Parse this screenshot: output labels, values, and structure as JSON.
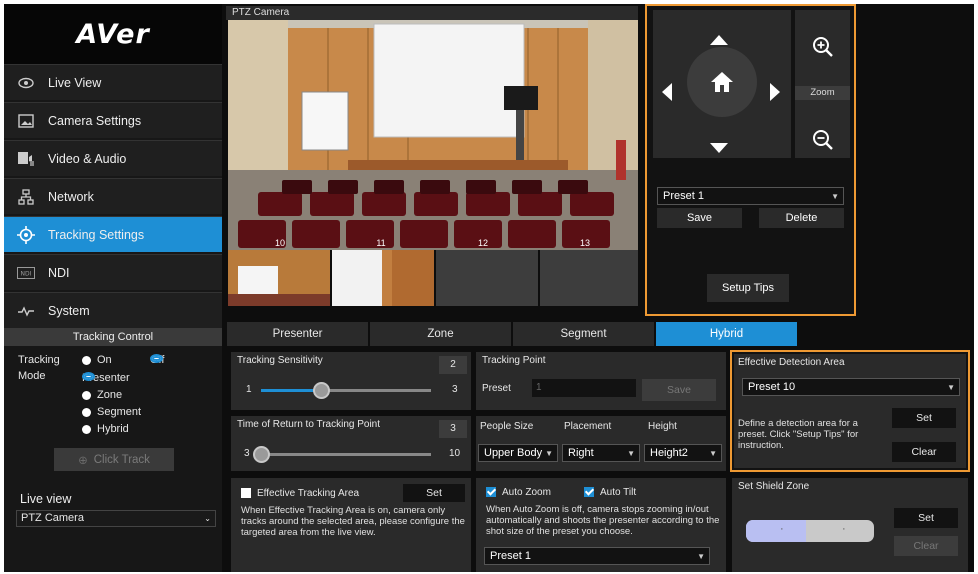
{
  "brand": {
    "logo_text": "AVer"
  },
  "sidebar": {
    "items": [
      {
        "label": "Live View",
        "icon": "eye-icon"
      },
      {
        "label": "Camera Settings",
        "icon": "image-icon"
      },
      {
        "label": "Video & Audio",
        "icon": "film-audio-icon"
      },
      {
        "label": "Network",
        "icon": "network-icon"
      },
      {
        "label": "Tracking Settings",
        "icon": "target-icon",
        "active": true
      },
      {
        "label": "NDI",
        "icon": "ndi-icon"
      },
      {
        "label": "System",
        "icon": "pulse-icon"
      }
    ],
    "tracking_control": {
      "header": "Tracking Control",
      "tracking_label": "Tracking",
      "mode_label": "Mode",
      "on_label": "On",
      "off_label": "Off",
      "state": "Off",
      "modes": [
        "Presenter",
        "Zone",
        "Segment",
        "Hybrid"
      ],
      "selected_mode": "Presenter",
      "click_track_label": "Click Track"
    },
    "live_view": {
      "label": "Live view",
      "selected": "PTZ Camera"
    }
  },
  "camera": {
    "title": "PTZ Camera",
    "segment_numbers": [
      "10",
      "11",
      "12",
      "13"
    ]
  },
  "ptz": {
    "zoom_label": "Zoom",
    "preset_selected": "Preset 1",
    "save_label": "Save",
    "delete_label": "Delete",
    "setup_tips_label": "Setup Tips"
  },
  "tabs": [
    {
      "label": "Presenter"
    },
    {
      "label": "Zone"
    },
    {
      "label": "Segment"
    },
    {
      "label": "Hybrid",
      "active": true
    }
  ],
  "tracking_sensitivity": {
    "title": "Tracking Sensitivity",
    "value": "2",
    "min": "1",
    "max": "3",
    "level": 2
  },
  "time_of_return": {
    "title": "Time of Return to Tracking Point",
    "value": "3",
    "min": "3",
    "max": "10",
    "level": 3
  },
  "tracking_point": {
    "title": "Tracking Point",
    "preset_label": "Preset",
    "preset_value": "1",
    "save_label": "Save"
  },
  "people": {
    "size_header": "People Size",
    "placement_header": "Placement",
    "height_header": "Height",
    "size_value": "Upper Body",
    "placement_value": "Right",
    "height_value": "Height2"
  },
  "effective_tracking_area": {
    "label": "Effective Tracking Area",
    "set_label": "Set",
    "description": "When Effective Tracking Area is on, camera only tracks around the selected area, please configure the targeted area from the live view."
  },
  "auto": {
    "auto_zoom_label": "Auto Zoom",
    "auto_tilt_label": "Auto Tilt",
    "description": "When Auto Zoom is off, camera stops zooming in/out automatically and shoots the presenter according to the shot size of the preset you choose.",
    "preset_selected": "Preset 1"
  },
  "effective_detection_area": {
    "title": "Effective Detection Area",
    "preset_selected": "Preset 10",
    "description": "Define a detection area for a preset. Click \"Setup Tips\" for instruction.",
    "set_label": "Set",
    "clear_label": "Clear"
  },
  "shield_zone": {
    "title": "Set Shield Zone",
    "set_label": "Set",
    "clear_label": "Clear"
  },
  "colors": {
    "accent": "#1e8fd5",
    "highlight": "#ee9933",
    "panel": "#2a2a2a"
  }
}
